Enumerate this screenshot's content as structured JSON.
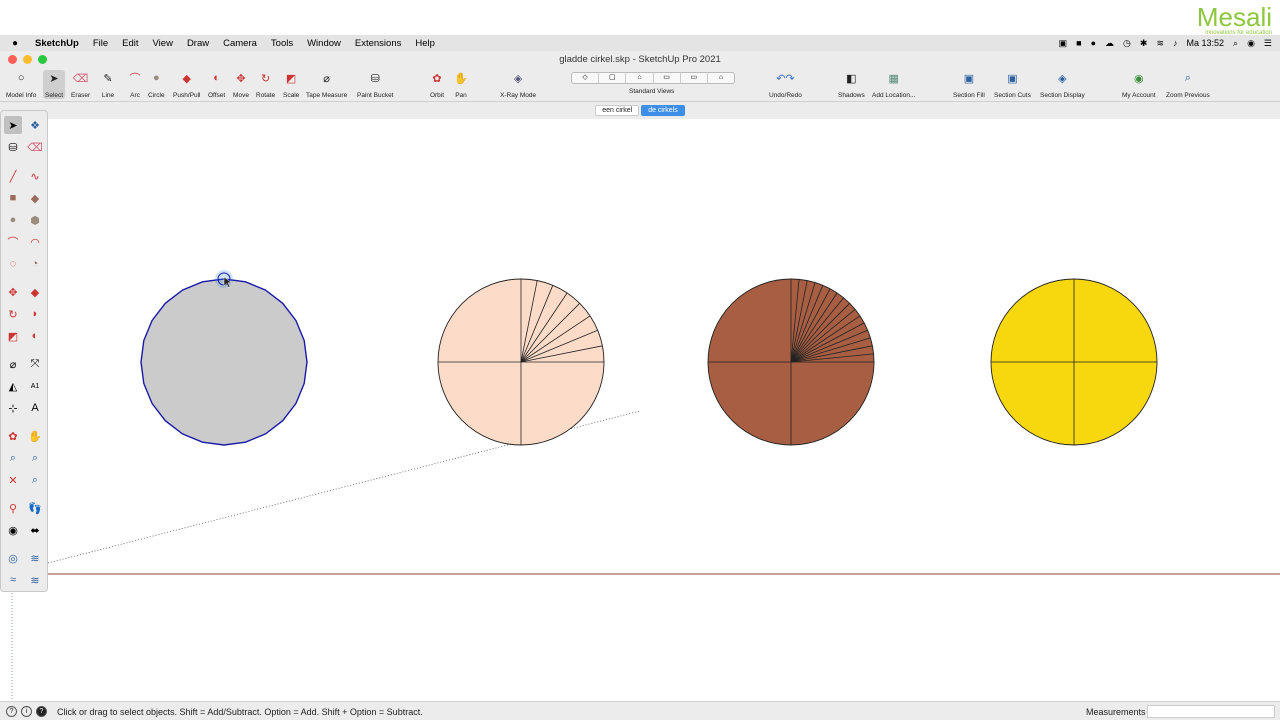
{
  "brand": {
    "name": "Mesali",
    "tagline": "innovations for education"
  },
  "menubar": {
    "app": "SketchUp",
    "items": [
      "File",
      "Edit",
      "View",
      "Draw",
      "Camera",
      "Tools",
      "Window",
      "Extensions",
      "Help"
    ],
    "clock": "Ma 13:52"
  },
  "window": {
    "title": "gladde cirkel.skp - SketchUp Pro 2021"
  },
  "toolbar": {
    "model_info": "Model Info",
    "select": "Select",
    "eraser": "Eraser",
    "line": "Line",
    "arc": "Arc",
    "circle": "Circle",
    "push_pull": "Push/Pull",
    "offset": "Offset",
    "move": "Move",
    "rotate": "Rotate",
    "scale": "Scale",
    "tape_measure": "Tape Measure",
    "paint_bucket": "Paint Bucket",
    "orbit": "Orbit",
    "pan": "Pan",
    "xray": "X-Ray Mode",
    "standard_views": "Standard Views",
    "undo_redo": "Undo/Redo",
    "shadows": "Shadows",
    "add_location": "Add Location...",
    "section_fill": "Section Fill",
    "section_cuts": "Section Cuts",
    "section_display": "Section Display",
    "my_account": "My Account",
    "zoom_previous": "Zoom Previous"
  },
  "scenes": [
    "een cirkel",
    "de cirkels"
  ],
  "active_scene": "de cirkels",
  "colors": {
    "circle1_fill": "#cbcbcb",
    "circle1_edge": "#1a1aa8",
    "circle2_fill": "#fcdcc8",
    "circle3_fill": "#a75e42",
    "circle4_fill": "#f7d70e",
    "ground_line": "#8b4a3c"
  },
  "status": {
    "message": "Click or drag to select objects. Shift = Add/Subtract. Option = Add. Shift + Option = Subtract.",
    "measurements_label": "Measurements",
    "measurements_value": ""
  }
}
